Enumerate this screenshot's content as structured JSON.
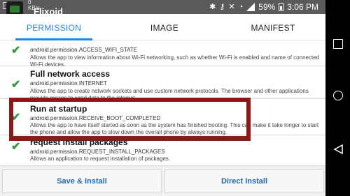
{
  "status_bar": {
    "notification_text": "0\nKB/s",
    "battery": "59%",
    "time": "3:06 PM"
  },
  "app": {
    "title": "Flixoid"
  },
  "tabs": [
    {
      "label": "PERMISSION",
      "active": true
    },
    {
      "label": "IMAGE",
      "active": false
    },
    {
      "label": "MANIFEST",
      "active": false
    }
  ],
  "permissions": [
    {
      "title": "",
      "code": "android.permission.ACCESS_WIFI_STATE",
      "description": "Allows the app to view information about Wi-Fi networking, such as whether Wi-Fi is enabled and name of connected Wi-Fi devices."
    },
    {
      "title": "Full network access",
      "code": "android.permission.INTERNET",
      "description": "Allows the app to create network sockets and use custom network protocols. The browser and other applications provide means to send data to the internet."
    },
    {
      "title": "Run at startup",
      "code": "android.permission.RECEIVE_BOOT_COMPLETED",
      "description": "Allows the app to have itself started as soon as the system has finished booting. This can make it take longer to start the phone and allow the app to slow down the overall phone by always running."
    },
    {
      "title": "request install packages",
      "code": "android.permission.REQUEST_INSTALL_PACKAGES",
      "description": "Allows an application to request installation of packages."
    }
  ],
  "buttons": {
    "save_install": "Save & Install",
    "direct_install": "Direct Install"
  },
  "colors": {
    "accent": "#1e88e5",
    "check": "#2e9b3c",
    "highlight": "#8a1a1a",
    "status_bar": "#5a5a5a"
  }
}
